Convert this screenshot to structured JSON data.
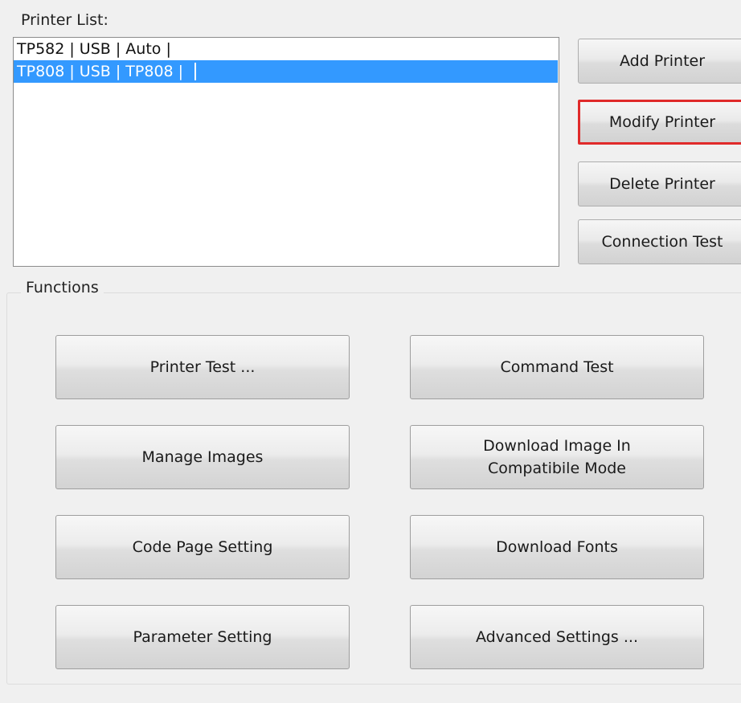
{
  "printer_list": {
    "label": "Printer List:",
    "rows": [
      {
        "text": "TP582 | USB | Auto |",
        "selected": false
      },
      {
        "text": "TP808 | USB | TP808 |",
        "selected": true
      }
    ]
  },
  "side_buttons": {
    "add": "Add Printer",
    "modify": "Modify Printer",
    "delete": "Delete Printer",
    "connection_test": "Connection Test"
  },
  "functions": {
    "label": "Functions",
    "printer_test": "Printer Test ...",
    "command_test": "Command Test",
    "manage_images": "Manage Images",
    "download_image_compat": "Download Image In\nCompatibile Mode",
    "code_page_setting": "Code Page Setting",
    "download_fonts": "Download Fonts",
    "parameter_setting": "Parameter Setting",
    "advanced_settings": "Advanced Settings ..."
  },
  "colors": {
    "selection": "#3399ff",
    "highlight_border": "#e02a2a",
    "panel_bg": "#f0f0f0"
  }
}
